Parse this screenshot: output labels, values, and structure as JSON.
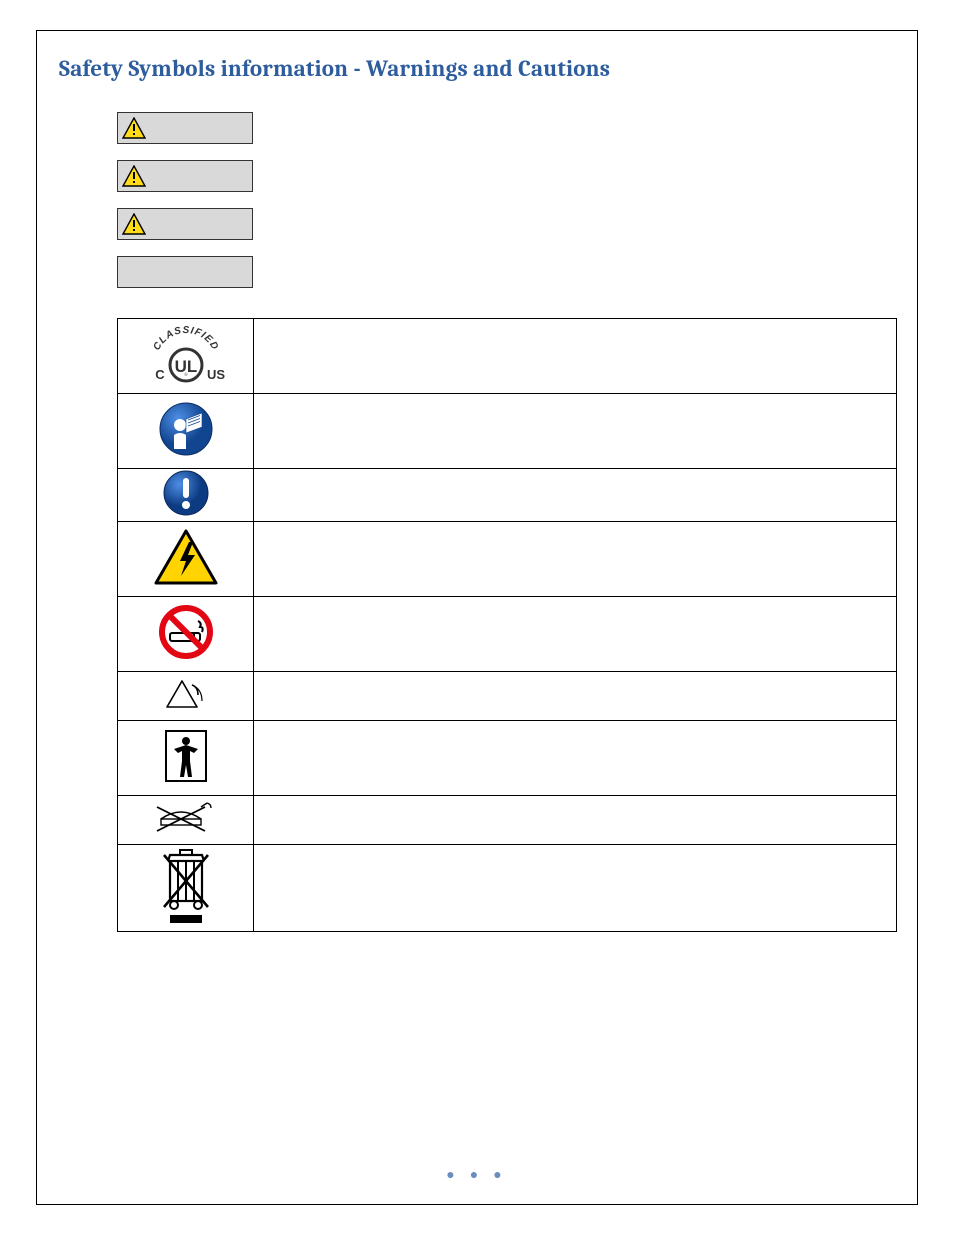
{
  "title": "Safety Symbols information - Warnings and Cautions",
  "warning_boxes": [
    {
      "has_triangle": true
    },
    {
      "has_triangle": true
    },
    {
      "has_triangle": true
    },
    {
      "has_triangle": false
    }
  ],
  "symbols": [
    {
      "name": "ul-classified-mark",
      "description": ""
    },
    {
      "name": "read-manual-icon",
      "description": ""
    },
    {
      "name": "mandatory-action-icon",
      "description": ""
    },
    {
      "name": "electric-shock-icon",
      "description": ""
    },
    {
      "name": "no-smoking-icon",
      "description": ""
    },
    {
      "name": "alarm-triangle-icon",
      "description": ""
    },
    {
      "name": "type-bf-applied-part-icon",
      "description": ""
    },
    {
      "name": "keep-dry-icon",
      "description": ""
    },
    {
      "name": "weee-disposal-icon",
      "description": ""
    }
  ],
  "ul_mark": {
    "arc_text": "CLASSIFIED",
    "left": "C",
    "right": "US",
    "center": "UL"
  },
  "footer": "● ● ●"
}
